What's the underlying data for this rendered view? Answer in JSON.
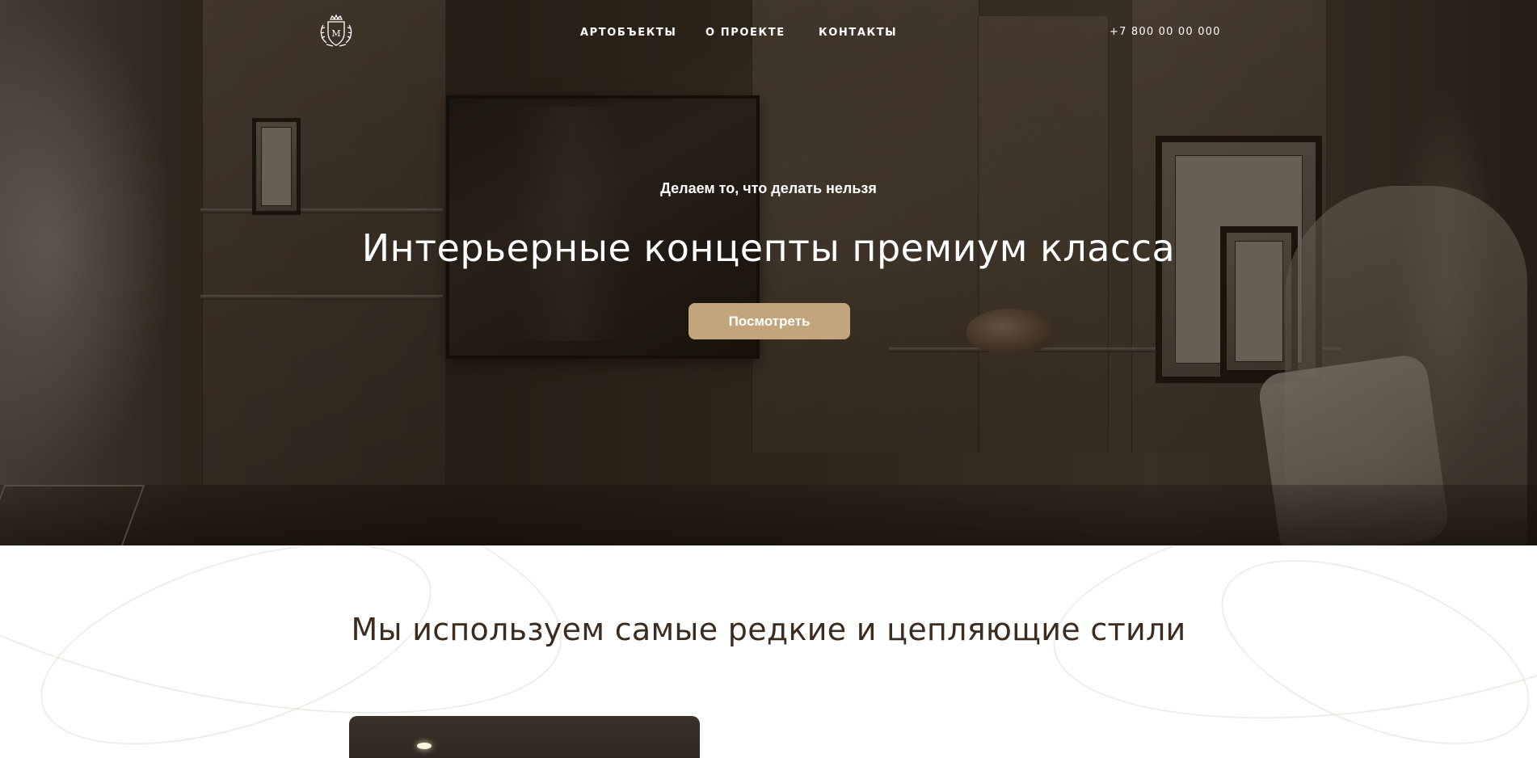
{
  "header": {
    "logo_icon": "crest-monogram-m-icon",
    "nav": [
      {
        "label": "АРТОБЪЕКТЫ"
      },
      {
        "label": "О ПРОЕКТЕ"
      },
      {
        "label": "КОНТАКТЫ"
      }
    ],
    "phone": "+7 800 00 00 000"
  },
  "hero": {
    "tagline": "Делаем то, что делать нельзя",
    "title": "Интерьерные концепты премиум класса",
    "cta_label": "Посмотреть"
  },
  "styles_section": {
    "title": "Мы используем самые редкие и цепляющие стили"
  },
  "colors": {
    "accent": "#c2a47d",
    "heading_dark": "#3b2c1f",
    "hero_text": "#ffffff"
  }
}
